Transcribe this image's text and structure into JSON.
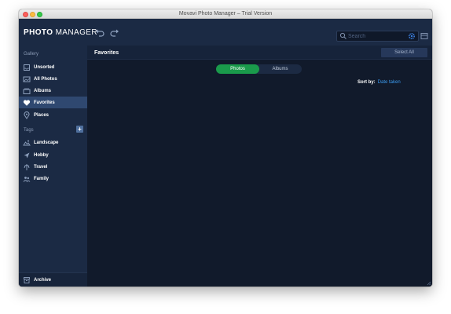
{
  "window": {
    "title": "Movavi Photo Manager – Trial Version"
  },
  "toolbar": {
    "logo_bold": "PHOTO",
    "logo_light": "MANAGER",
    "search_placeholder": "Search",
    "undo_icon": "undo-icon",
    "redo_icon": "redo-icon"
  },
  "sidebar": {
    "gallery_label": "Gallery",
    "gallery_items": [
      {
        "label": "Unsorted",
        "icon": "unsorted-icon"
      },
      {
        "label": "All Photos",
        "icon": "photos-icon"
      },
      {
        "label": "Albums",
        "icon": "albums-icon"
      },
      {
        "label": "Favorites",
        "icon": "heart-icon",
        "active": true
      },
      {
        "label": "Places",
        "icon": "location-pin-icon"
      }
    ],
    "tags_label": "Tags",
    "add_tag": "+",
    "tag_items": [
      {
        "label": "Landscape",
        "icon": "landscape-tag-icon"
      },
      {
        "label": "Hobby",
        "icon": "hobby-tag-icon"
      },
      {
        "label": "Travel",
        "icon": "travel-tag-icon"
      },
      {
        "label": "Family",
        "icon": "family-tag-icon"
      }
    ],
    "archive_label": "Archive"
  },
  "main": {
    "title": "Favorites",
    "select_all": "Select All",
    "tabs": [
      {
        "label": "Photos",
        "active": true
      },
      {
        "label": "Albums",
        "active": false
      }
    ],
    "sort_label": "Sort by:",
    "sort_value": "Date taken"
  },
  "colors": {
    "accent_green": "#1a9a4b",
    "link_blue": "#3b9bf0",
    "sidebar_bg": "#1b2a44",
    "content_bg": "#111a2b",
    "active_item_bg": "#2f4870"
  }
}
